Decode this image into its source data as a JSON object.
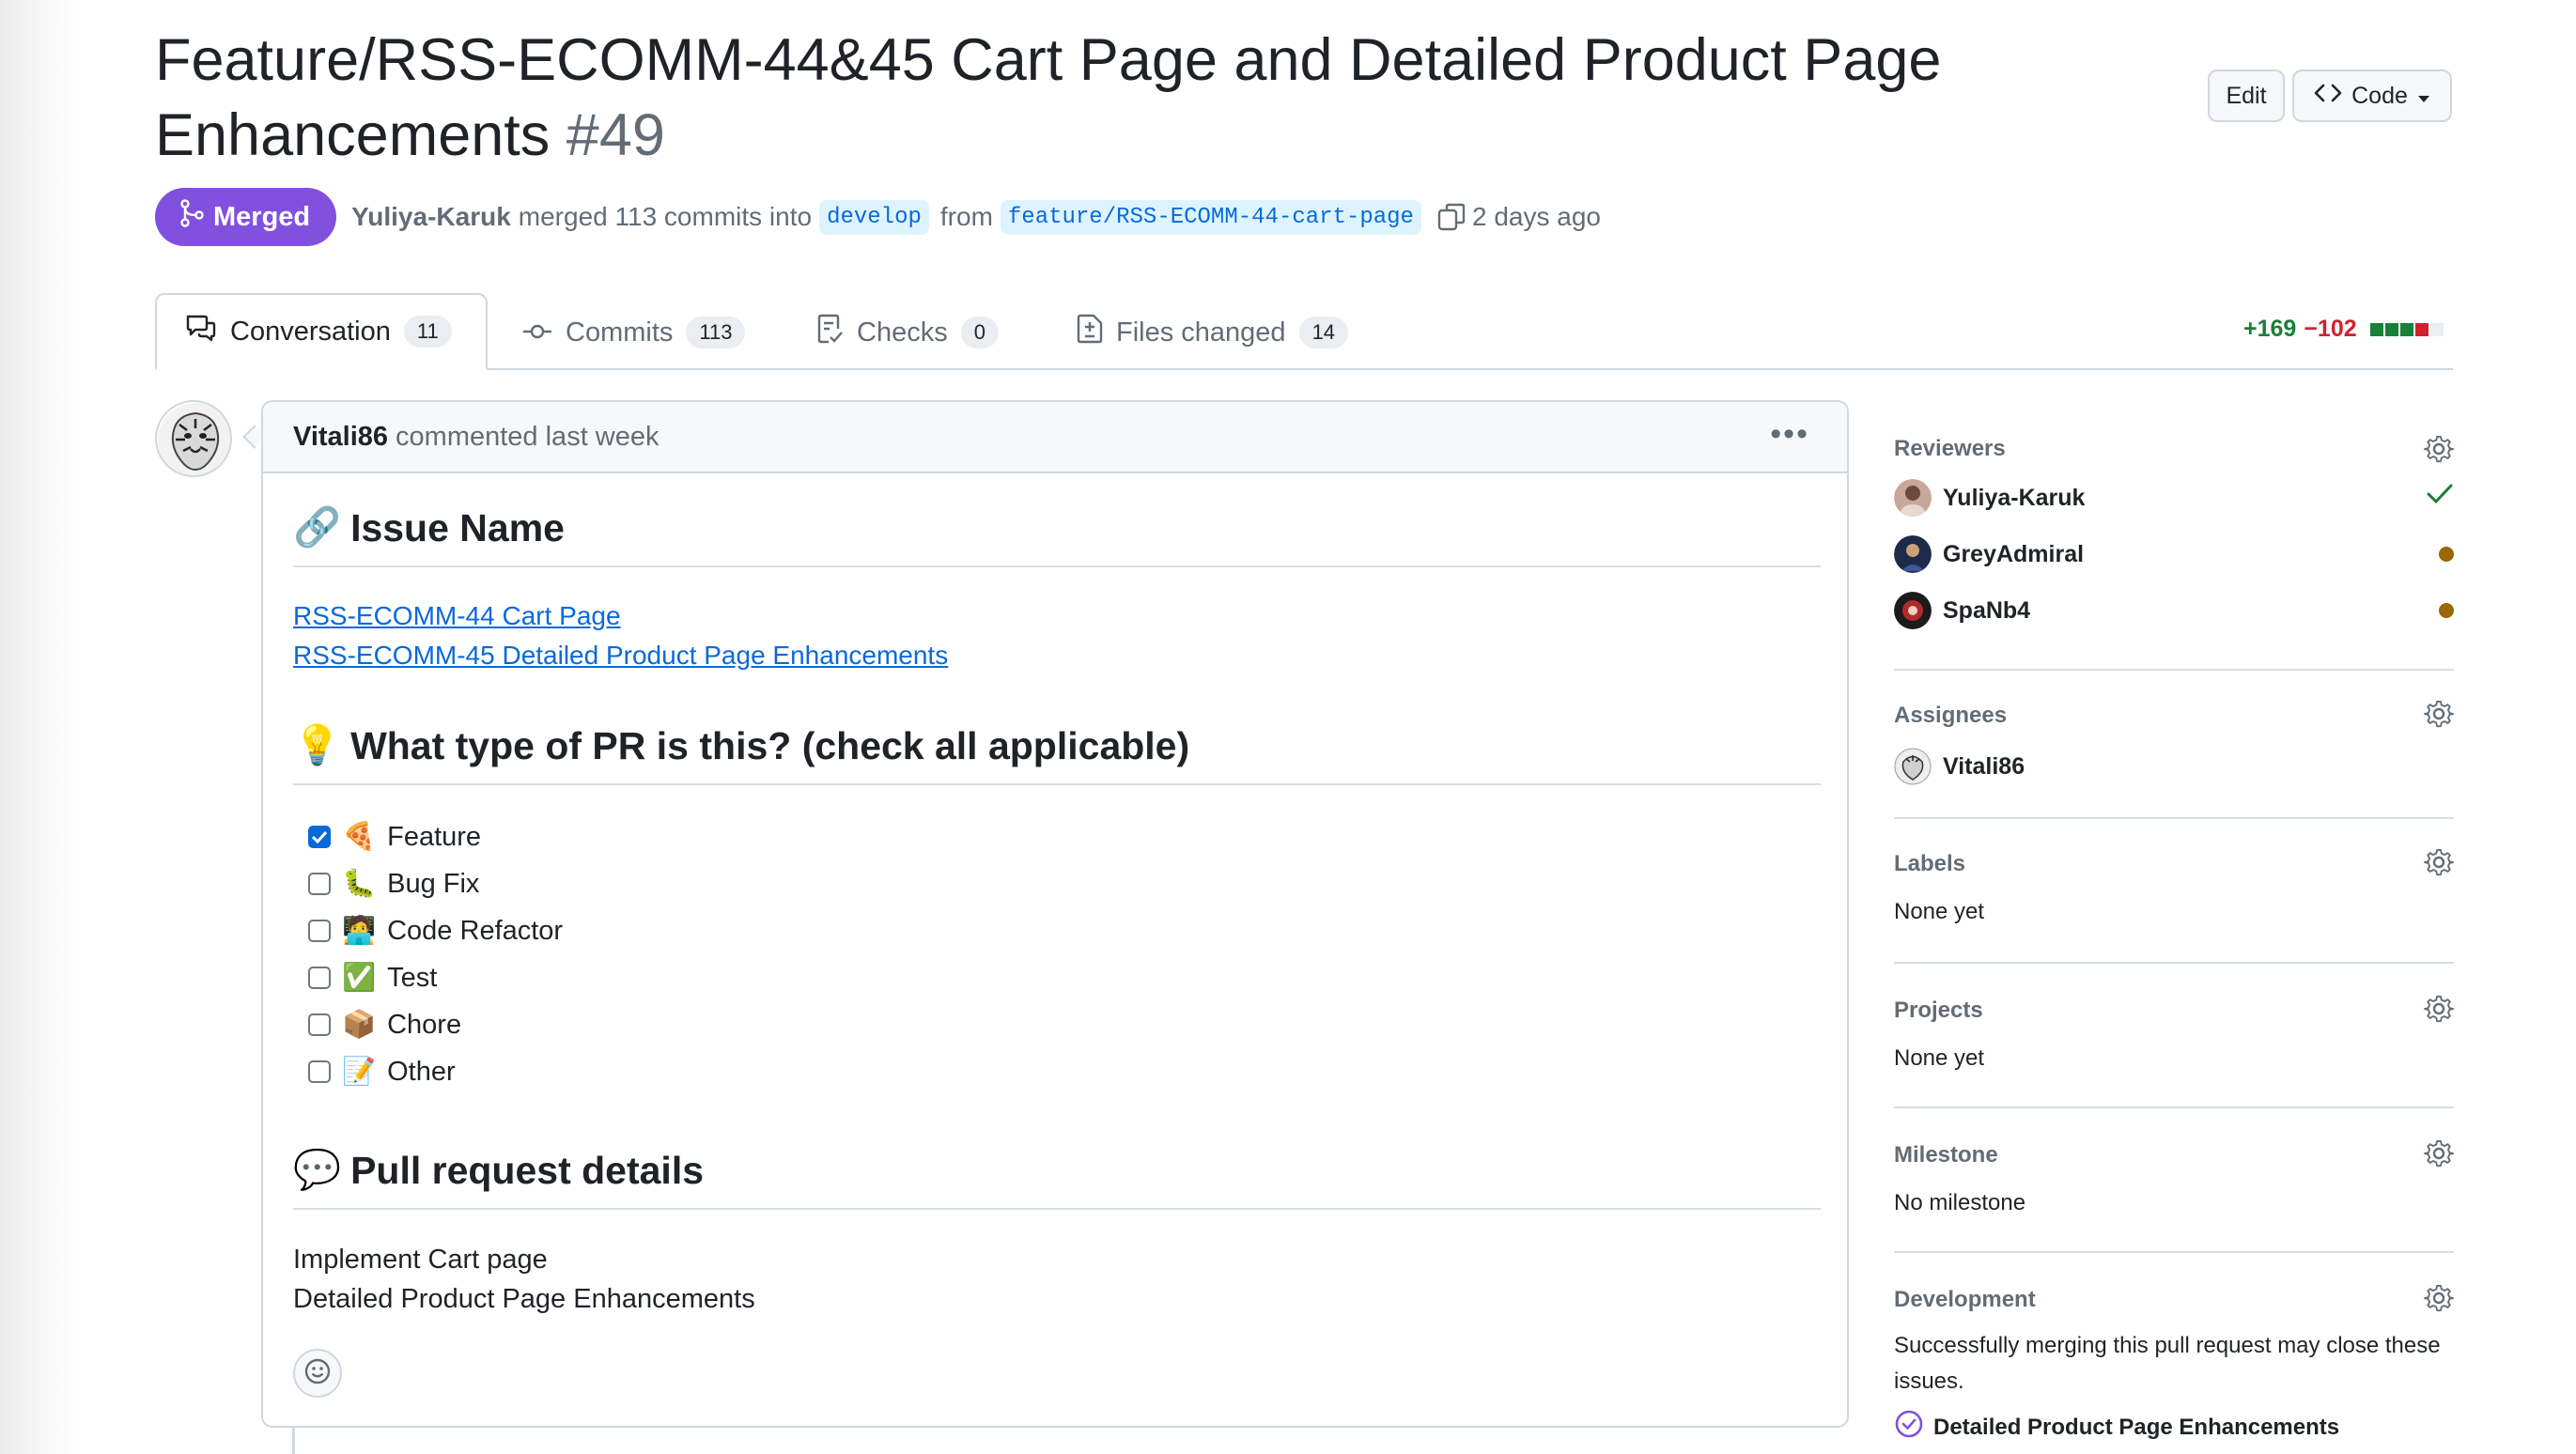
{
  "pr": {
    "title": "Feature/RSS-ECOMM-44&45 Cart Page and Detailed Product Page Enhancements",
    "number": "#49",
    "edit_label": "Edit",
    "code_label": "Code",
    "status": "Merged",
    "author": "Yuliya-Karuk",
    "merge_text": "merged 113 commits into",
    "base_branch": "develop",
    "from_text": "from",
    "head_branch": "feature/RSS-ECOMM-44-cart-page",
    "time_ago": "2 days ago"
  },
  "tabs": [
    {
      "label": "Conversation",
      "count": "11",
      "icon": "comment-discussion-icon"
    },
    {
      "label": "Commits",
      "count": "113",
      "icon": "git-commit-icon"
    },
    {
      "label": "Checks",
      "count": "0",
      "icon": "checklist-icon"
    },
    {
      "label": "Files changed",
      "count": "14",
      "icon": "file-diff-icon"
    }
  ],
  "diffstat": {
    "additions": "+169",
    "deletions": "−102",
    "colors": [
      "#1a7f37",
      "#1a7f37",
      "#1a7f37",
      "#cf222e",
      "#eaeef2"
    ]
  },
  "comment": {
    "author": "Vitali86",
    "action": "commented last week",
    "sections": {
      "issue_heading": "Issue Name",
      "issue_links": [
        "RSS-ECOMM-44 Cart Page",
        "RSS-ECOMM-45 Detailed Product Page Enhancements"
      ],
      "type_heading": "What type of PR is this? (check all applicable)",
      "types": [
        {
          "emoji": "🍕",
          "label": "Feature",
          "checked": true
        },
        {
          "emoji": "🐛",
          "label": "Bug Fix",
          "checked": false
        },
        {
          "emoji": "🧑‍💻",
          "label": "Code Refactor",
          "checked": false
        },
        {
          "emoji": "✅",
          "label": "Test",
          "checked": false
        },
        {
          "emoji": "📦",
          "label": "Chore",
          "checked": false
        },
        {
          "emoji": "📝",
          "label": "Other",
          "checked": false
        }
      ],
      "details_heading": "Pull request details",
      "details_lines": [
        "Implement Cart page",
        "Detailed Product Page Enhancements"
      ]
    }
  },
  "sidebar": {
    "reviewers_heading": "Reviewers",
    "reviewers": [
      {
        "name": "Yuliya-Karuk",
        "status": "approved"
      },
      {
        "name": "GreyAdmiral",
        "status": "pending"
      },
      {
        "name": "SpaNb4",
        "status": "pending"
      }
    ],
    "assignees_heading": "Assignees",
    "assignees": [
      "Vitali86"
    ],
    "labels_heading": "Labels",
    "labels_value": "None yet",
    "projects_heading": "Projects",
    "projects_value": "None yet",
    "milestone_heading": "Milestone",
    "milestone_value": "No milestone",
    "development_heading": "Development",
    "development_text": "Successfully merging this pull request may close these issues.",
    "development_issue": "Detailed Product Page Enhancements"
  },
  "colors": {
    "merged": "#8250df",
    "link": "#0969da",
    "pending": "#9a6700",
    "approved": "#1a7f37"
  }
}
